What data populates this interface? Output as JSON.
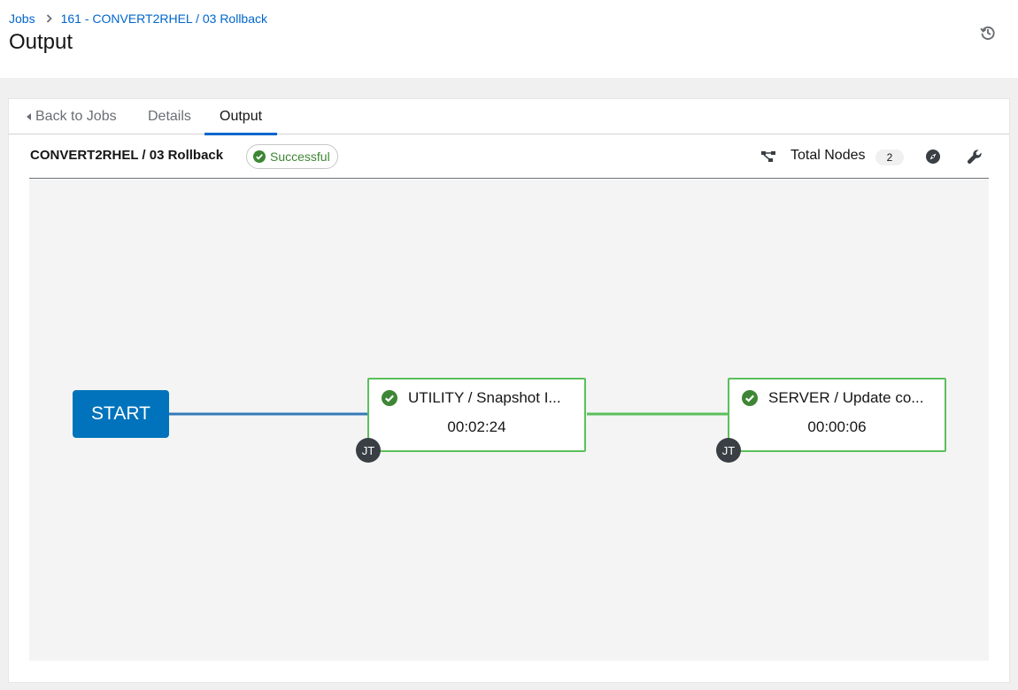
{
  "breadcrumb": {
    "root": "Jobs",
    "current": "161 - CONVERT2RHEL / 03 Rollback"
  },
  "page": {
    "title": "Output"
  },
  "tabs": {
    "back": "Back to Jobs",
    "details": "Details",
    "output": "Output"
  },
  "toolbar": {
    "workflow_title": "CONVERT2RHEL / 03 Rollback",
    "status": "Successful",
    "total_nodes_label": "Total Nodes",
    "total_nodes_count": "2",
    "icons": [
      "topology-icon",
      "compass-icon",
      "wrench-icon"
    ]
  },
  "graph": {
    "start_label": "START",
    "nodes": [
      {
        "name": "UTILITY / Snapshot I...",
        "elapsed": "00:02:24",
        "badge": "JT",
        "status": "successful"
      },
      {
        "name": "SERVER / Update co...",
        "elapsed": "00:00:06",
        "badge": "JT",
        "status": "successful"
      }
    ]
  },
  "colors": {
    "link": "#0066cc",
    "success": "#3e8635",
    "node_border": "#5ac05a",
    "start": "#0073bc",
    "edge_start": "#337ab7",
    "edge_success": "#5ac05a"
  }
}
